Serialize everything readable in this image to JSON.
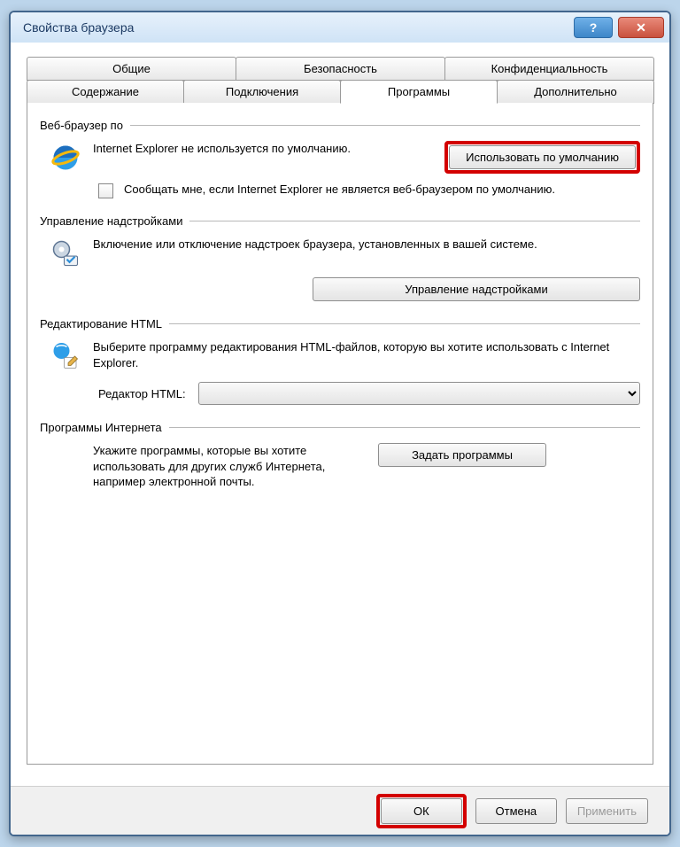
{
  "title": "Свойства браузера",
  "tabs_row1": [
    "Общие",
    "Безопасность",
    "Конфиденциальность"
  ],
  "tabs_row2": [
    "Содержание",
    "Подключения",
    "Программы",
    "Дополнительно"
  ],
  "active_tab": "Программы",
  "groups": {
    "default_browser": {
      "title": "Веб-браузер по",
      "status": "Internet Explorer не используется по умолчанию.",
      "button": "Использовать по умолчанию",
      "checkbox": "Сообщать мне, если Internet Explorer не является веб-браузером по умолчанию."
    },
    "addons": {
      "title": "Управление надстройками",
      "desc": "Включение или отключение надстроек браузера, установленных в вашей системе.",
      "button": "Управление надстройками"
    },
    "html_edit": {
      "title": "Редактирование HTML",
      "desc": "Выберите программу редактирования HTML-файлов, которую вы хотите использовать с Internet Explorer.",
      "label": "Редактор HTML:",
      "value": ""
    },
    "internet_programs": {
      "title": "Программы Интернета",
      "desc": "Укажите программы, которые вы хотите использовать для других служб Интернета, например электронной почты.",
      "button": "Задать программы"
    }
  },
  "footer": {
    "ok": "ОК",
    "cancel": "Отмена",
    "apply": "Применить"
  }
}
